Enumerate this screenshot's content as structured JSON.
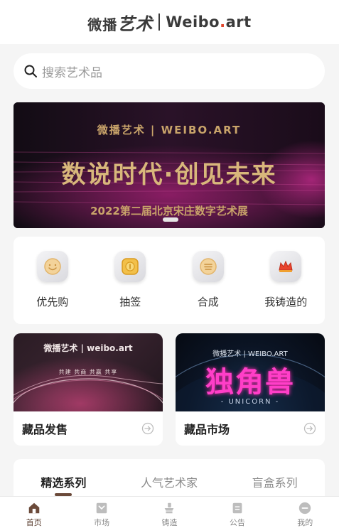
{
  "header": {
    "logo_cn_a": "微播",
    "logo_cn_b": "艺术",
    "logo_en_a": "Weibo",
    "logo_en_dot": ".",
    "logo_en_b": "art"
  },
  "search": {
    "placeholder": "搜索艺术品",
    "icon": "search-icon"
  },
  "banner": {
    "brand": "微播艺术 | WEIBO.ART",
    "title": "数说时代·创见未来",
    "subtitle": "2022第二届北京宋庄数字艺术展",
    "slide_index": 1,
    "slide_count": 1
  },
  "actions": [
    {
      "label": "优先购",
      "icon": "smile-icon"
    },
    {
      "label": "抽签",
      "icon": "coin-icon"
    },
    {
      "label": "合成",
      "icon": "layers-icon"
    },
    {
      "label": "我铸造的",
      "icon": "crown-icon"
    }
  ],
  "cards": [
    {
      "title": "藏品发售",
      "image_brand": "微播艺术 | weibo.art",
      "image_caption": "共建  共商  共赢  共享",
      "icon": "arrow-right-icon"
    },
    {
      "title": "藏品市场",
      "image_brand": "微播艺术 | WEIBO.ART",
      "image_title": "独角兽",
      "image_caption": "- UNICORN -",
      "icon": "arrow-right-icon"
    }
  ],
  "series_tabs": [
    {
      "label": "精选系列",
      "active": true
    },
    {
      "label": "人气艺术家",
      "active": false
    },
    {
      "label": "盲盒系列",
      "active": false
    }
  ],
  "tabbar": [
    {
      "label": "首页",
      "icon": "home-icon",
      "active": true
    },
    {
      "label": "市场",
      "icon": "market-icon",
      "active": false
    },
    {
      "label": "铸造",
      "icon": "anvil-icon",
      "active": false
    },
    {
      "label": "公告",
      "icon": "notice-icon",
      "active": false
    },
    {
      "label": "我的",
      "icon": "profile-icon",
      "active": false
    }
  ],
  "colors": {
    "accent": "#5a3e30",
    "logo_dot": "#e0442a",
    "banner_gold": "#d8b77b",
    "unicorn_pink": "#ff3ec8"
  }
}
